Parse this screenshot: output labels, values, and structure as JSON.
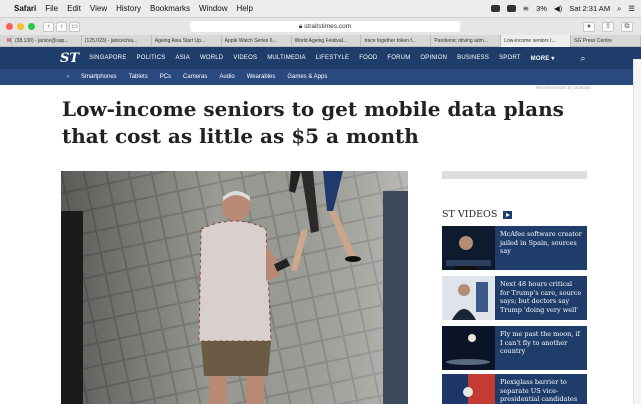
{
  "menubar": {
    "app": "Safari",
    "items": [
      "File",
      "Edit",
      "View",
      "History",
      "Bookmarks",
      "Window",
      "Help"
    ],
    "battery": "3%",
    "clock": "Sat 2:31 AM"
  },
  "browser": {
    "url": "straitstimes.com",
    "tabs": [
      "M",
      "(38,130) - janice@sap...",
      "(125,023) - janicechia...",
      "Ageing Asia Start Up...",
      "Apple Watch Series 6...",
      "World Ageing Festival...",
      "trace together token f...",
      "Pandemic driving adm...",
      "Low-income seniors t...",
      "SG Press Centre"
    ],
    "active_tab": 8
  },
  "site": {
    "logo": "ST",
    "nav": [
      "SINGAPORE",
      "POLITICS",
      "ASIA",
      "WORLD",
      "VIDEOS",
      "MULTIMEDIA",
      "LIFESTYLE",
      "FOOD",
      "FORUM",
      "OPINION",
      "BUSINESS",
      "SPORT"
    ],
    "more": "MORE ▾",
    "subnav_arrow": "›",
    "subnav": [
      "Smartphones",
      "Tablets",
      "PCs",
      "Cameras",
      "Audio",
      "Wearables",
      "Games & Apps"
    ],
    "sponsor": "Recommended by Outbrain"
  },
  "article": {
    "headline": "Low-income seniors to get mobile data plans that cost as little as $5 a month"
  },
  "videos": {
    "heading": "ST VIDEOS",
    "items": [
      {
        "title": "McAfee software creator jailed in Spain, sources say"
      },
      {
        "title": "Next 48 hours critical for Trump's care, source says; but doctors say Trump 'doing very well'"
      },
      {
        "title": "Fly me past the moon, if I can't fly to another country"
      },
      {
        "title": "Plexiglass barrier to separate US vice-presidential candidates at"
      }
    ]
  },
  "colors": {
    "nav": "#1f3d6b",
    "subnav": "#2a4a7f"
  }
}
